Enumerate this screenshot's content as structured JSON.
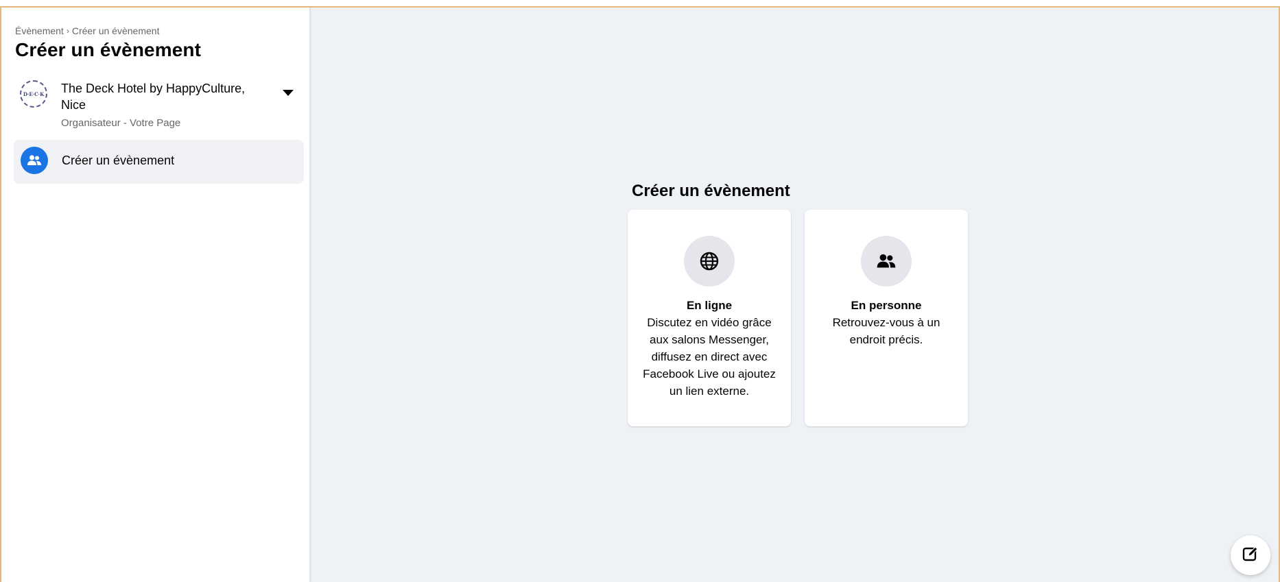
{
  "breadcrumb": {
    "parent": "Évènement",
    "separator": "›",
    "current": "Créer un évènement"
  },
  "sidebar": {
    "title": "Créer un évènement",
    "page": {
      "avatar_text": "D·E·C·K",
      "name": "The Deck Hotel by HappyCulture, Nice",
      "subtitle": "Organisateur - Votre Page"
    },
    "nav_item": {
      "label": "Créer un évènement",
      "icon": "people-icon"
    }
  },
  "main": {
    "title": "Créer un évènement",
    "cards": [
      {
        "icon": "globe-icon",
        "title": "En ligne",
        "description": "Discutez en vidéo grâce aux salons Messenger, diffusez en direct avec Facebook Live ou ajoutez un lien externe."
      },
      {
        "icon": "people-icon",
        "title": "En personne",
        "description": "Retrouvez-vous à un endroit précis."
      }
    ]
  },
  "colors": {
    "accent": "#1b74e4",
    "main_background": "#eef1f5",
    "frame_border": "#e7b97a"
  },
  "compose_button": {
    "icon": "compose-icon"
  }
}
